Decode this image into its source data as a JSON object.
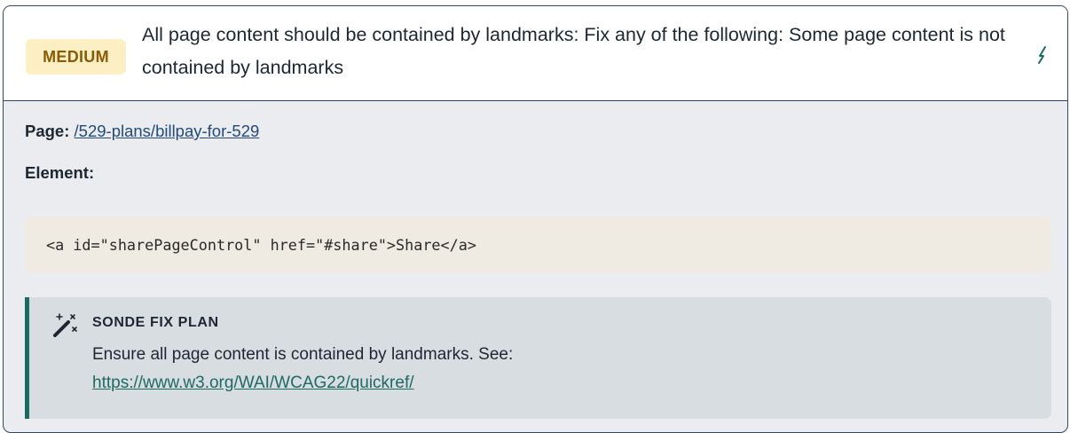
{
  "issue": {
    "severity": "MEDIUM",
    "title": "All page content should be contained by landmarks: Fix any of the following: Some page content is not contained by landmarks",
    "action_icon": "bolt-icon"
  },
  "details": {
    "page_label": "Page:",
    "page_link": "/529-plans/billpay-for-529",
    "element_label": "Element:",
    "element_code": "<a id=\"sharePageControl\" href=\"#share\">Share</a>"
  },
  "fix_plan": {
    "icon": "magic-wand-icon",
    "heading": "SONDE FIX PLAN",
    "text": "Ensure all page content is contained by landmarks. See:",
    "link": "https://www.w3.org/WAI/WCAG22/quickref/"
  },
  "colors": {
    "badge_bg": "#fcefc4",
    "badge_text": "#8a5a07",
    "accent": "#1d6a61",
    "link": "#234a7a",
    "border": "#33485e"
  }
}
